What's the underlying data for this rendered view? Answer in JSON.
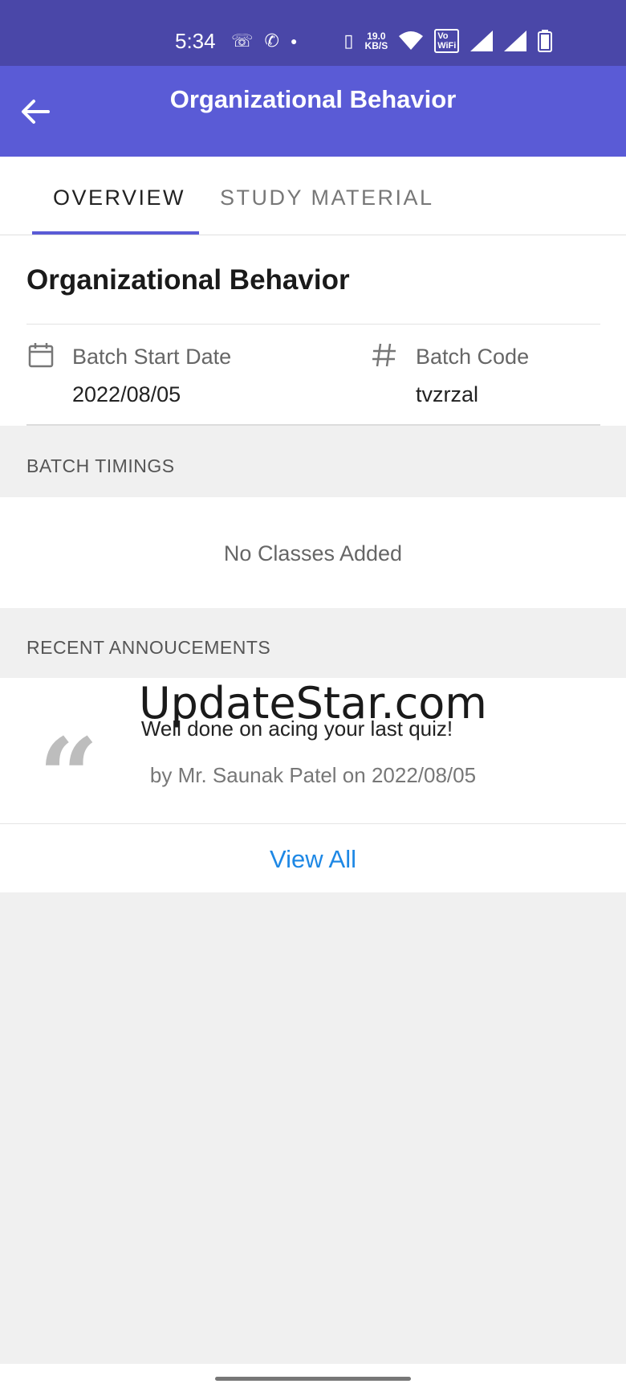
{
  "status_bar": {
    "time": "5:34",
    "icons": [
      "whatsapp-icon",
      "missed-call-icon",
      "dot-icon",
      "vibrate-icon",
      "network-speed-icon",
      "wifi-icon",
      "vowifi-icon",
      "signal-icon",
      "signal-icon",
      "battery-icon"
    ],
    "speed_value": "19.0",
    "speed_unit": "KB/S",
    "vowifi_top": "Vo",
    "vowifi_bottom": "WiFi"
  },
  "app_bar": {
    "title": "Organizational Behavior",
    "back_icon": "arrow-left-icon"
  },
  "tabs": [
    {
      "label": "OVERVIEW",
      "active": true
    },
    {
      "label": "STUDY MATERIAL",
      "active": false
    }
  ],
  "overview": {
    "course_title": "Organizational Behavior",
    "start_date_label": "Batch Start Date",
    "start_date_value": "2022/08/05",
    "batch_code_label": "Batch Code",
    "batch_code_value": "tvzrzal"
  },
  "batch_timings": {
    "header": "BATCH TIMINGS",
    "empty_text": "No Classes Added"
  },
  "announcements": {
    "header": "RECENT ANNOUCEMENTS",
    "watermark": "UpdateStar.com",
    "quote_glyph": "“",
    "message": "Well done on acing your last quiz!",
    "meta": "by Mr. Saunak Patel on 2022/08/05",
    "view_all": "View All"
  },
  "colors": {
    "status_bar": "#4a47a8",
    "app_bar": "#5a5bd6",
    "link": "#1e88e5"
  }
}
